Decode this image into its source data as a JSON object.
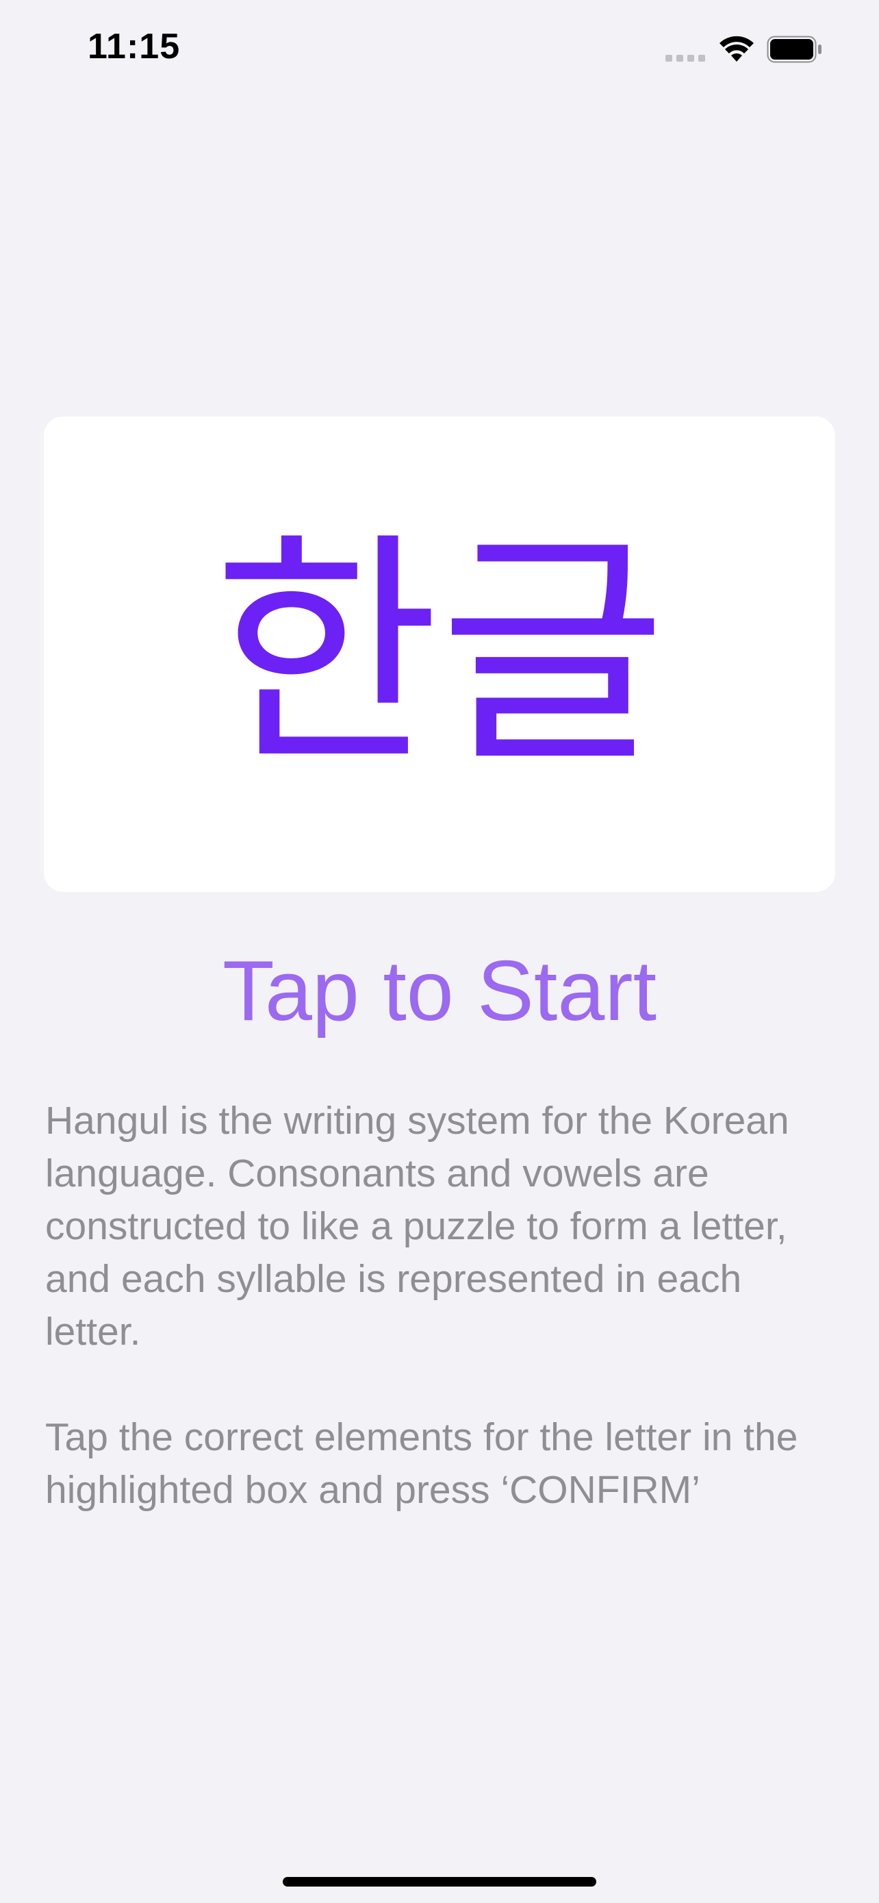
{
  "status_bar": {
    "time": "11:15"
  },
  "card": {
    "title": "한글"
  },
  "start_label": "Tap to Start",
  "description": "Hangul is the writing system for the Korean language. Consonants and vowels are constructed to like a puzzle to form a letter, and each syllable is represented in each letter.",
  "instruction": "Tap the correct elements for the letter in the highlighted box and press ‘CONFIRM’",
  "colors": {
    "background": "#f2f2f7",
    "card": "#ffffff",
    "hangul": "#6c22f4",
    "accent": "#9b6af0",
    "body_text": "#8e8e93"
  },
  "icons": [
    "cellular-icon",
    "wifi-icon",
    "battery-icon"
  ]
}
